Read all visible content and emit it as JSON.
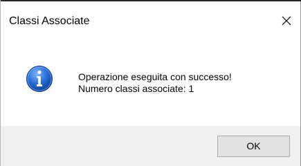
{
  "window": {
    "title": "Classi Associate",
    "close_icon": "close-icon"
  },
  "message": {
    "icon": "info-icon",
    "line1": "Operazione eseguita con successo!",
    "line2": "Numero classi associate: 1"
  },
  "buttons": {
    "ok_label": "OK"
  },
  "colors": {
    "footer_bg": "#f0f0f0",
    "icon_blue": "#1f5fbf"
  }
}
